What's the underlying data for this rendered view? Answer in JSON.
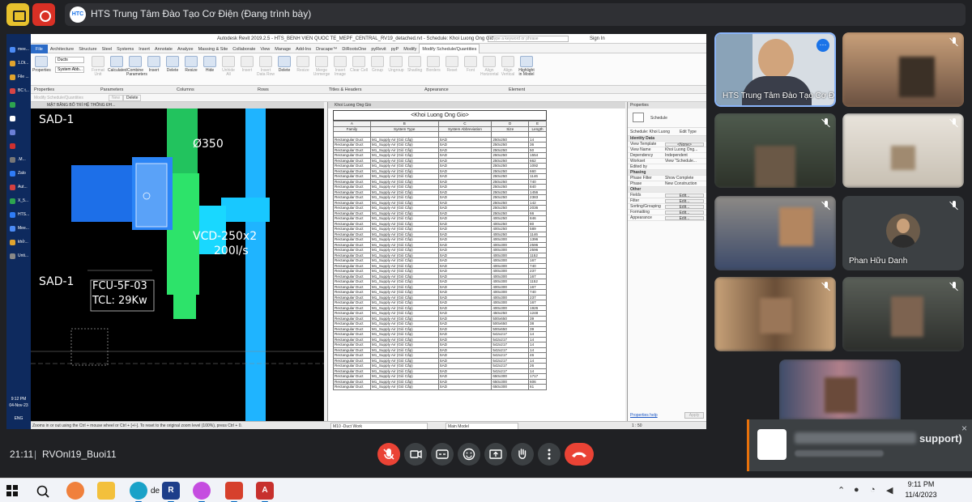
{
  "topbar": {
    "presenter_title": "HTS Trung Tâm Đào Tạo Cơ Điện (Đang trình bày)",
    "logo_text": "HTC"
  },
  "win_sidebar": {
    "items": [
      {
        "label": "mee...",
        "color": "#4c8bf5"
      },
      {
        "label": "1.Dt...",
        "color": "#e0a32e"
      },
      {
        "label": "File ...",
        "color": "#e0a32e"
      },
      {
        "label": "BC t...",
        "color": "#d64545"
      },
      {
        "label": "",
        "color": "#2ea44f"
      },
      {
        "label": "",
        "color": "#ffffff"
      },
      {
        "label": "",
        "color": "#6b7fd6"
      },
      {
        "label": "",
        "color": "#ce3030"
      },
      {
        "label": ".M...",
        "color": "#777777"
      },
      {
        "label": "Zalo",
        "color": "#2f7cf6"
      },
      {
        "label": "Aut...",
        "color": "#d44040"
      },
      {
        "label": "X_5...",
        "color": "#2ea44f"
      },
      {
        "label": "HTS...",
        "color": "#2f7cf6"
      },
      {
        "label": "Mee...",
        "color": "#4c8bf5"
      },
      {
        "label": "khở...",
        "color": "#e0a32e"
      },
      {
        "label": "Unti...",
        "color": "#888888"
      }
    ],
    "lang": "ENG",
    "time": "9:12 PM",
    "date": "04-Nov-23"
  },
  "revit": {
    "title": "Autodesk Revit 2019.2.5 - HTS_BENH VIEN QUOC TE_MEPF_CENTRAL_RV19_detached.rvt - Schedule: Khoi Luong Ong Gio",
    "search_placeholder": "Type a keyword or phrase",
    "sign_in": "Sign In",
    "tabs": [
      "File",
      "Architecture",
      "Structure",
      "Steel",
      "Systems",
      "Insert",
      "Annotate",
      "Analyze",
      "Massing & Site",
      "Collaborate",
      "View",
      "Manage",
      "Add-Ins",
      "Dracape™",
      "DiRootsOne",
      "pyRevit",
      "pyP",
      "Modify",
      "Modify Schedule/Quantities"
    ],
    "active_tab": "Modify Schedule/Quantities",
    "ribbon_buttons": [
      {
        "label": "Properties",
        "dim": false
      },
      {
        "label": "Format Unit",
        "dim": true
      },
      {
        "label": "Calculated",
        "dim": false
      },
      {
        "label": "Combine Parameters",
        "dim": false
      },
      {
        "label": "Insert",
        "dim": false
      },
      {
        "label": "Delete",
        "dim": false
      },
      {
        "label": "Resize",
        "dim": false
      },
      {
        "label": "Hide",
        "dim": false
      },
      {
        "label": "Unhide All",
        "dim": true
      },
      {
        "label": "Insert",
        "dim": true
      },
      {
        "label": "Insert Data Row",
        "dim": true
      },
      {
        "label": "Delete",
        "dim": false
      },
      {
        "label": "Resize",
        "dim": true
      },
      {
        "label": "Merge Unmerge",
        "dim": true
      },
      {
        "label": "Insert Image",
        "dim": true
      },
      {
        "label": "Clear Cell",
        "dim": true
      },
      {
        "label": "Group",
        "dim": true
      },
      {
        "label": "Ungroup",
        "dim": true
      },
      {
        "label": "Shading",
        "dim": true
      },
      {
        "label": "Borders",
        "dim": true
      },
      {
        "label": "Reset",
        "dim": true
      },
      {
        "label": "Font",
        "dim": true
      },
      {
        "label": "Align Horizontal",
        "dim": true
      },
      {
        "label": "Align Vertical",
        "dim": true
      },
      {
        "label": "Highlight in Model",
        "dim": false
      }
    ],
    "ribbon_groups": [
      "Properties",
      "Parameters",
      "Columns",
      "Rows",
      "Titles & Headers",
      "Appearance",
      "Element"
    ],
    "dropdown_1": "Ducts",
    "dropdown_2": "System Abb...",
    "option_bar": [
      "Modify Schedule/Quantities",
      "New",
      "Delete"
    ],
    "cad": {
      "tab": "MẶT BẰNG BỐ TRÍ HỆ THỐNG ĐH...",
      "labels": [
        "SAD-1",
        "Ø350",
        "VCD-250x2",
        "200l/s",
        "SAD-1",
        "FCU-5F-03",
        "TCL: 29Kw"
      ]
    },
    "schedule": {
      "tab": "Khoi Luong Ong Gio",
      "title": "<Khoi Luong Ong Gio>",
      "col_letters": [
        "A",
        "B",
        "C",
        "D",
        "E"
      ],
      "col_headers": [
        "Family",
        "System Type",
        "System Abbreviation",
        "Size",
        "Length"
      ],
      "rows": [
        [
          "Rectangular Duct",
          "M1_Supply Air (Gió Cấp)",
          "SAD",
          "250x250",
          "14"
        ],
        [
          "Rectangular Duct",
          "M1_Supply Air (Gió Cấp)",
          "SAD",
          "250x250",
          "36"
        ],
        [
          "Rectangular Duct",
          "M1_Supply Air (Gió Cấp)",
          "SAD",
          "250x250",
          "50"
        ],
        [
          "Rectangular Duct",
          "M1_Supply Air (Gió Cấp)",
          "SAD",
          "250x250",
          "1554"
        ],
        [
          "Rectangular Duct",
          "M1_Supply Air (Gió Cấp)",
          "SAD",
          "250x250",
          "662"
        ],
        [
          "Rectangular Duct",
          "M1_Supply Air (Gió Cấp)",
          "SAD",
          "250x250",
          "1092"
        ],
        [
          "Rectangular Duct",
          "M1_Supply Air (Gió Cấp)",
          "SAD",
          "250x250",
          "660"
        ],
        [
          "Rectangular Duct",
          "M1_Supply Air (Gió Cấp)",
          "SAD",
          "250x250",
          "1146"
        ],
        [
          "Rectangular Duct",
          "M1_Supply Air (Gió Cấp)",
          "SAD",
          "250x250",
          "740"
        ],
        [
          "Rectangular Duct",
          "M1_Supply Air (Gió Cấp)",
          "SAD",
          "250x250",
          "840"
        ],
        [
          "Rectangular Duct",
          "M1_Supply Air (Gió Cấp)",
          "SAD",
          "250x250",
          "1456"
        ],
        [
          "Rectangular Duct",
          "M1_Supply Air (Gió Cấp)",
          "SAD",
          "250x250",
          "2383"
        ],
        [
          "Rectangular Duct",
          "M1_Supply Air (Gió Cấp)",
          "SAD",
          "250x250",
          "142"
        ],
        [
          "Rectangular Duct",
          "M1_Supply Air (Gió Cấp)",
          "SAD",
          "250x250",
          "2036"
        ],
        [
          "Rectangular Duct",
          "M1_Supply Air (Gió Cấp)",
          "SAD",
          "250x250",
          "66"
        ],
        [
          "Rectangular Duct",
          "M1_Supply Air (Gió Cấp)",
          "SAD",
          "400x250",
          "846"
        ],
        [
          "Rectangular Duct",
          "M1_Supply Air (Gió Cấp)",
          "SAD",
          "400x250",
          "80"
        ],
        [
          "Rectangular Duct",
          "M1_Supply Air (Gió Cấp)",
          "SAD",
          "400x250",
          "589"
        ],
        [
          "Rectangular Duct",
          "M1_Supply Air (Gió Cấp)",
          "SAD",
          "400x250",
          "1146"
        ],
        [
          "Rectangular Duct",
          "M1_Supply Air (Gió Cấp)",
          "SAD",
          "400x300",
          "1396"
        ],
        [
          "Rectangular Duct",
          "M1_Supply Air (Gió Cấp)",
          "SAD",
          "400x300",
          "2596"
        ],
        [
          "Rectangular Duct",
          "M1_Supply Air (Gió Cấp)",
          "SAD",
          "400x300",
          "2596"
        ],
        [
          "Rectangular Duct",
          "M1_Supply Air (Gió Cấp)",
          "SAD",
          "400x300",
          "1152"
        ],
        [
          "Rectangular Duct",
          "M1_Supply Air (Gió Cấp)",
          "SAD",
          "400x300",
          "167"
        ],
        [
          "Rectangular Duct",
          "M1_Supply Air (Gió Cấp)",
          "SAD",
          "400x300",
          "740"
        ],
        [
          "Rectangular Duct",
          "M1_Supply Air (Gió Cấp)",
          "SAD",
          "400x300",
          "237"
        ],
        [
          "Rectangular Duct",
          "M1_Supply Air (Gió Cấp)",
          "SAD",
          "400x300",
          "167"
        ],
        [
          "Rectangular Duct",
          "M1_Supply Air (Gió Cấp)",
          "SAD",
          "400x300",
          "1152"
        ],
        [
          "Rectangular Duct",
          "M1_Supply Air (Gió Cấp)",
          "SAD",
          "400x300",
          "167"
        ],
        [
          "Rectangular Duct",
          "M1_Supply Air (Gió Cấp)",
          "SAD",
          "400x300",
          "740"
        ],
        [
          "Rectangular Duct",
          "M1_Supply Air (Gió Cấp)",
          "SAD",
          "400x300",
          "237"
        ],
        [
          "Rectangular Duct",
          "M1_Supply Air (Gió Cấp)",
          "SAD",
          "400x300",
          "167"
        ],
        [
          "Rectangular Duct",
          "M1_Supply Air (Gió Cấp)",
          "SAD",
          "400x300",
          "1926"
        ],
        [
          "Rectangular Duct",
          "M1_Supply Air (Gió Cấp)",
          "SAD",
          "450x250",
          "1248"
        ],
        [
          "Rectangular Duct",
          "M1_Supply Air (Gió Cấp)",
          "SAD",
          "500x650",
          "39"
        ],
        [
          "Rectangular Duct",
          "M1_Supply Air (Gió Cấp)",
          "SAD",
          "500x650",
          "38"
        ],
        [
          "Rectangular Duct",
          "M1_Supply Air (Gió Cấp)",
          "SAD",
          "500x650",
          "39"
        ],
        [
          "Rectangular Duct",
          "M1_Supply Air (Gió Cấp)",
          "SAD",
          "542x217",
          "14"
        ],
        [
          "Rectangular Duct",
          "M1_Supply Air (Gió Cấp)",
          "SAD",
          "542x217",
          "14"
        ],
        [
          "Rectangular Duct",
          "M1_Supply Air (Gió Cấp)",
          "SAD",
          "542x217",
          "14"
        ],
        [
          "Rectangular Duct",
          "M1_Supply Air (Gió Cấp)",
          "SAD",
          "542x217",
          "14"
        ],
        [
          "Rectangular Duct",
          "M1_Supply Air (Gió Cấp)",
          "SAD",
          "542x217",
          "46"
        ],
        [
          "Rectangular Duct",
          "M1_Supply Air (Gió Cấp)",
          "SAD",
          "542x217",
          "14"
        ],
        [
          "Rectangular Duct",
          "M1_Supply Air (Gió Cấp)",
          "SAD",
          "542x217",
          "26"
        ],
        [
          "Rectangular Duct",
          "M1_Supply Air (Gió Cấp)",
          "SAD",
          "542x217",
          "14"
        ],
        [
          "Rectangular Duct",
          "M1_Supply Air (Gió Cấp)",
          "SAD",
          "650x300",
          "1717"
        ],
        [
          "Rectangular Duct",
          "M1_Supply Air (Gió Cấp)",
          "SAD",
          "650x300",
          "606"
        ],
        [
          "Rectangular Duct",
          "M1_Supply Air (Gió Cấp)",
          "SAD",
          "650x300",
          "61"
        ]
      ]
    },
    "properties": {
      "header": "Properties",
      "type_name": "Schedule",
      "selector": "Schedule: Khoi Luong",
      "edit_type": "Edit Type",
      "rows": [
        {
          "sec": "Identity Data"
        },
        {
          "k": "View Template",
          "b": "<None>"
        },
        {
          "k": "View Name",
          "v": "Khoi Luong Ong..."
        },
        {
          "k": "Dependency",
          "v": "Independent"
        },
        {
          "k": "Workset",
          "v": "View \"Schedule..."
        },
        {
          "k": "Edited by",
          "v": ""
        },
        {
          "sec": "Phasing"
        },
        {
          "k": "Phase Filter",
          "v": "Show Complete"
        },
        {
          "k": "Phase",
          "v": "New Construction"
        },
        {
          "sec": "Other"
        },
        {
          "k": "Fields",
          "b": "Edit..."
        },
        {
          "k": "Filter",
          "b": "Edit..."
        },
        {
          "k": "Sorting/Grouping",
          "b": "Edit..."
        },
        {
          "k": "Formatting",
          "b": "Edit..."
        },
        {
          "k": "Appearance",
          "b": "Edit..."
        }
      ],
      "help": "Properties help",
      "apply": "Apply"
    },
    "status": {
      "hint": "Zooms in or out using the Ctrl + mouse wheel or Ctrl + [+/-]. To reset to the original zoom level (100%), press Ctrl + 0.",
      "workset": "M10 -Duct Work",
      "model": "Main Model",
      "scale": "1 : 50"
    }
  },
  "tiles": [
    {
      "name": "HTS Trung Tâm Đào Tạo Cơ Đi...",
      "active": true,
      "more": true
    },
    {
      "name": "",
      "active": false,
      "more": false
    },
    {
      "name": "",
      "active": false,
      "more": false
    },
    {
      "name": "",
      "active": false,
      "more": false
    },
    {
      "name": "",
      "active": false,
      "more": false
    },
    {
      "name": "Phan Hữu Danh",
      "active": false,
      "more": false
    },
    {
      "name": "",
      "active": false,
      "more": false
    },
    {
      "name": "",
      "active": false,
      "more": false
    }
  ],
  "toast": {
    "visible_text": "support)",
    "close": "×"
  },
  "controls": {
    "time": "21:11",
    "separator": "|",
    "meeting_code": "RVOnl19_Buoi11"
  },
  "taskbar": {
    "time": "9:11 PM",
    "date": "11/4/2023",
    "label_de": "de"
  }
}
